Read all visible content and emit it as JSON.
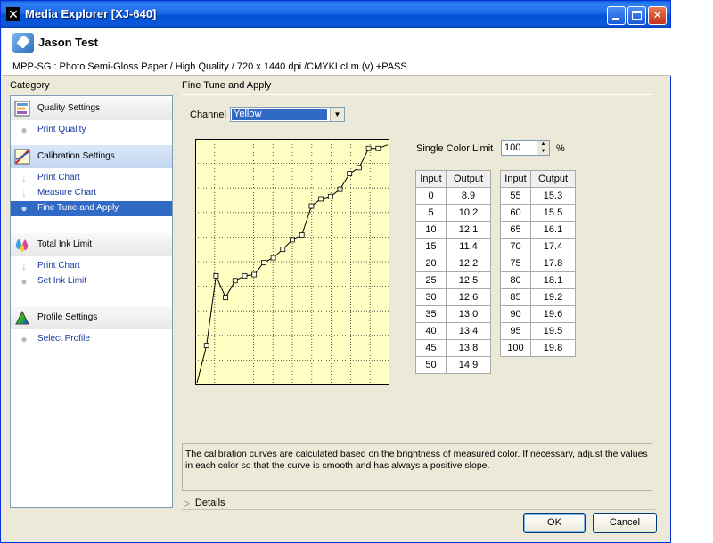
{
  "window": {
    "title": "Media Explorer [XJ-640]"
  },
  "header": {
    "user_name": "Jason Test",
    "media_description": "MPP-SG : Photo Semi-Gloss Paper / High Quality / 720 x 1440 dpi /CMYKLcLm (v) +PASS"
  },
  "sidebar": {
    "label": "Category",
    "sections": [
      {
        "title": "Quality Settings",
        "icon": "quality-settings-icon",
        "items": [
          "Print Quality"
        ]
      },
      {
        "title": "Calibration Settings",
        "icon": "calibration-icon",
        "items": [
          "Print Chart",
          "Measure Chart",
          "Fine Tune and Apply"
        ],
        "selected": "Fine Tune and Apply"
      },
      {
        "title": "Total Ink Limit",
        "icon": "ink-drops-icon",
        "items": [
          "Print Chart",
          "Set Ink Limit"
        ]
      },
      {
        "title": "Profile Settings",
        "icon": "color-profile-icon",
        "items": [
          "Select Profile"
        ]
      }
    ]
  },
  "content": {
    "title": "Fine Tune and Apply",
    "channel_label": "Channel",
    "channel_value": "Yellow",
    "single_color_limit_label": "Single Color Limit",
    "single_color_limit_value": "100",
    "single_color_limit_unit": "%",
    "table_headers": {
      "input": "Input",
      "output": "Output"
    },
    "description": "The calibration curves are calculated based on the brightness of measured color.  If necessary, adjust the values in each color so that the curve is smooth and has always a positive slope.",
    "details_label": "Details"
  },
  "buttons": {
    "ok": "OK",
    "cancel": "Cancel"
  },
  "chart_data": {
    "type": "line",
    "title": "",
    "xlabel": "",
    "ylabel": "",
    "xlim": [
      0,
      100
    ],
    "ylim": [
      0,
      20
    ],
    "grid": true,
    "background_color": "#ffffc4",
    "line_color": "#000000",
    "x": [
      0,
      5,
      10,
      15,
      20,
      25,
      30,
      35,
      40,
      45,
      50,
      55,
      60,
      65,
      70,
      75,
      80,
      85,
      90,
      95,
      100
    ],
    "values": [
      0,
      3.1,
      8.9,
      7.1,
      8.5,
      8.9,
      9.0,
      10.0,
      10.4,
      11.1,
      11.9,
      12.3,
      14.7,
      15.3,
      15.5,
      16.1,
      17.4,
      17.9,
      19.5,
      19.5,
      19.8
    ]
  },
  "table_data": {
    "left": [
      [
        "0",
        "8.9"
      ],
      [
        "5",
        "10.2"
      ],
      [
        "10",
        "12.1"
      ],
      [
        "15",
        "11.4"
      ],
      [
        "20",
        "12.2"
      ],
      [
        "25",
        "12.5"
      ],
      [
        "30",
        "12.6"
      ],
      [
        "35",
        "13.0"
      ],
      [
        "40",
        "13.4"
      ],
      [
        "45",
        "13.8"
      ],
      [
        "50",
        "14.9"
      ]
    ],
    "right": [
      [
        "55",
        "15.3"
      ],
      [
        "60",
        "15.5"
      ],
      [
        "65",
        "16.1"
      ],
      [
        "70",
        "17.4"
      ],
      [
        "75",
        "17.8"
      ],
      [
        "80",
        "18.1"
      ],
      [
        "85",
        "19.2"
      ],
      [
        "90",
        "19.6"
      ],
      [
        "95",
        "19.5"
      ],
      [
        "100",
        "19.8"
      ]
    ]
  }
}
